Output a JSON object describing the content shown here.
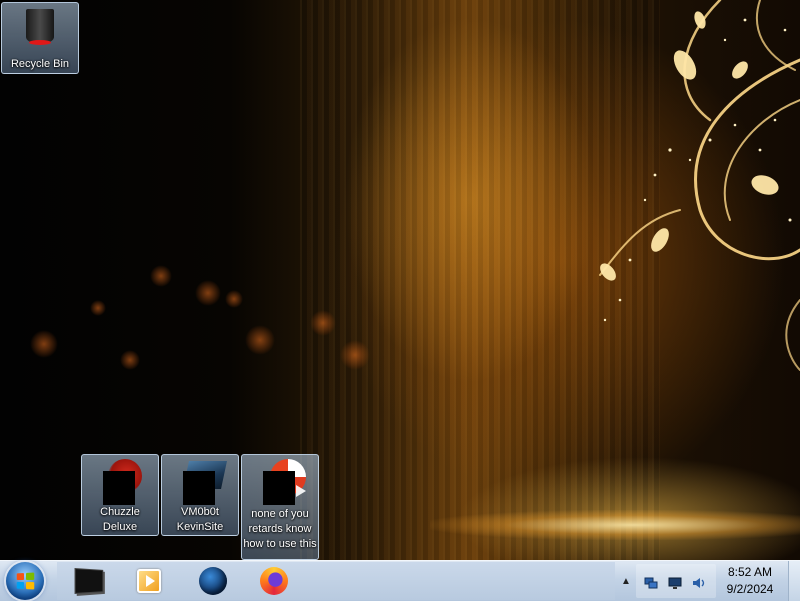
{
  "desktop": {
    "icons": [
      {
        "label": "Recycle Bin",
        "icon": "recycle-bin-icon"
      },
      {
        "label": "Chuzzle Deluxe",
        "icon": "chuzzle-app-icon"
      },
      {
        "label": "VM0b0t KevinSite",
        "icon": "vm-shortcut-icon"
      },
      {
        "label": "none of you retards know how to use this",
        "icon": "firefox-shortcut-icon"
      }
    ]
  },
  "taskbar": {
    "start_icon": "windows-start-orb",
    "pinned": [
      {
        "name": "terminal",
        "icon": "terminal-icon"
      },
      {
        "name": "media-player",
        "icon": "media-player-icon"
      },
      {
        "name": "globe-app",
        "icon": "globe-icon"
      },
      {
        "name": "firefox",
        "icon": "firefox-icon"
      }
    ],
    "tray": {
      "chevron": "▲",
      "icons": [
        "network-icon",
        "display-icon",
        "volume-icon"
      ]
    },
    "clock": {
      "time": "8:52 AM",
      "date": "9/2/2024"
    }
  },
  "colors": {
    "start_flag": [
      "#f65314",
      "#7cbb00",
      "#00a1f1",
      "#ffbb00"
    ],
    "wallpaper_accent": "#f0a030"
  }
}
